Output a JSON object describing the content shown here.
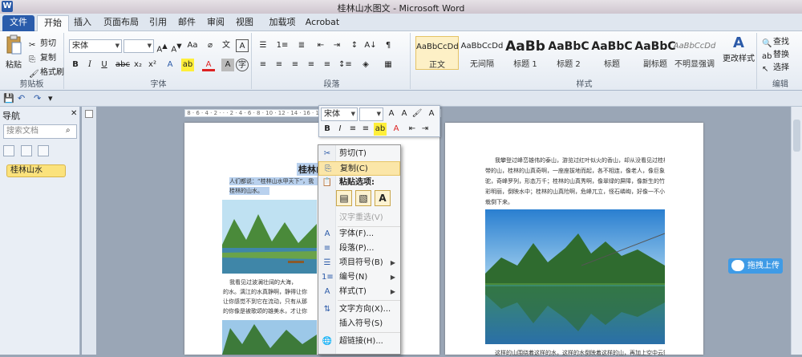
{
  "window": {
    "title": "桂林山水图文 - Microsoft Word",
    "app_icon": "W"
  },
  "tabs": [
    "文件",
    "开始",
    "插入",
    "页面布局",
    "引用",
    "邮件",
    "审阅",
    "视图",
    "加载项",
    "Acrobat"
  ],
  "clipboard": {
    "paste": "粘贴",
    "cut": "剪切",
    "copy": "复制",
    "format_painter": "格式刷",
    "label": "剪贴板"
  },
  "font": {
    "name": "宋体",
    "label": "字体"
  },
  "paragraph": {
    "label": "段落"
  },
  "styles": {
    "label": "样式",
    "items": [
      {
        "sample": "AaBbCcDd",
        "name": "正文"
      },
      {
        "sample": "AaBbCcDd",
        "name": "无间隔"
      },
      {
        "sample": "AaBb",
        "name": "标题 1"
      },
      {
        "sample": "AaBbC",
        "name": "标题 2"
      },
      {
        "sample": "AaBbC",
        "name": "标题"
      },
      {
        "sample": "AaBbC",
        "name": "副标题"
      },
      {
        "sample": "AaBbCcDd",
        "name": "不明显强调"
      }
    ],
    "change": "更改样式"
  },
  "editing": {
    "find": "查找",
    "replace": "替换",
    "select": "选择",
    "label": "编辑"
  },
  "nav": {
    "title": "导航",
    "search_placeholder": "搜索文档",
    "heading": "桂林山水"
  },
  "document": {
    "title": "桂林山水",
    "page1_lines": [
      "人们都说：“桂林山水甲天下”，我",
      "桂林的山水。",
      "我看见过波澜壮阔的大海，",
      "的水。漓江的水真静啊，静得让你",
      "让你感觉不到它在流动，只有从那",
      "的你像是被歌颂的雄美水，才让你"
    ],
    "page2_lines": [
      "我攀登过峰峦雄伟的泰山，游览过红叶似火的香山，却从没看见过桂林这一",
      "带的山，桂林的山真奇啊，一座座拔地而起，各不相连，像老人，像巨象，像骆",
      "驼，奇峰罗列，形态万千；桂林的山真秀啊，像翠绿的屏障，像新生的竹笋，色",
      "彩明丽，倒映水中；桂林的山真险啊，危峰兀立，怪石嶙峋，好像一不小心就会",
      "栽倒下来。",
      "这样的山围绕着这样的水，这样的水倒映着这样的山，再加上空中云雾迷蒙，"
    ]
  },
  "mini_toolbar": {
    "font": "宋体"
  },
  "context_menu": {
    "items": [
      {
        "label": "剪切(T)",
        "icon": "scissors-icon"
      },
      {
        "label": "复制(C)",
        "icon": "copy-icon"
      },
      {
        "label": "粘贴选项:",
        "icon": "clipboard-icon"
      },
      {
        "label": "汉字重选(V)",
        "icon": ""
      },
      {
        "label": "字体(F)...",
        "icon": "font-icon"
      },
      {
        "label": "段落(P)...",
        "icon": "paragraph-icon"
      },
      {
        "label": "项目符号(B)",
        "icon": "bullets-icon"
      },
      {
        "label": "编号(N)",
        "icon": "numbering-icon"
      },
      {
        "label": "样式(T)",
        "icon": "styles-icon"
      },
      {
        "label": "文字方向(X)...",
        "icon": "text-direction-icon"
      },
      {
        "label": "插入符号(S)",
        "icon": ""
      },
      {
        "label": "超链接(H)...",
        "icon": "hyperlink-icon"
      }
    ]
  },
  "upload_widget": {
    "label": "拖拽上传"
  }
}
